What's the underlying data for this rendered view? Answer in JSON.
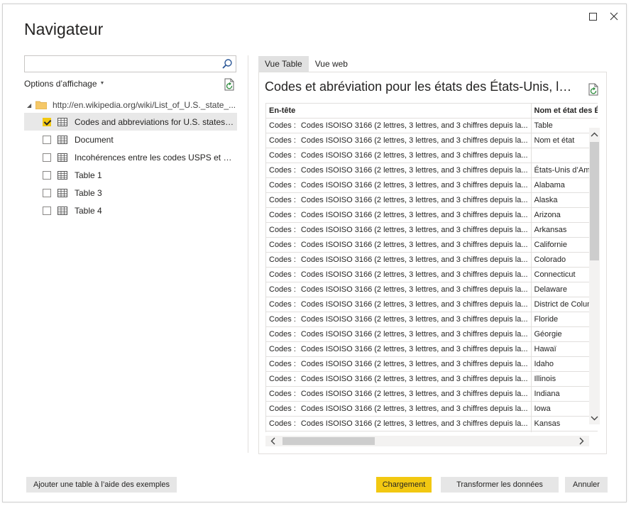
{
  "window": {
    "title": "Navigateur",
    "maximize_icon": "maximize-icon",
    "close_icon": "close-icon"
  },
  "left": {
    "search": {
      "value": "",
      "placeholder": ""
    },
    "display_options": "Options d’affichage",
    "tree": {
      "root_url": "http://en.wikipedia.org/wiki/List_of_U.S._state_...",
      "items": [
        {
          "label": "Codes and abbreviations for U.S. states, ...",
          "checked": true,
          "selected": true
        },
        {
          "label": "Document",
          "checked": false,
          "selected": false
        },
        {
          "label": "Incohérences entre les codes USPS et USCG",
          "checked": false,
          "selected": false
        },
        {
          "label": "Table 1",
          "checked": false,
          "selected": false
        },
        {
          "label": "Table 3",
          "checked": false,
          "selected": false
        },
        {
          "label": "Table 4",
          "checked": false,
          "selected": false
        }
      ]
    }
  },
  "right": {
    "tabs": [
      {
        "label": "Vue Table",
        "active": true
      },
      {
        "label": "Vue web",
        "active": false
      }
    ],
    "preview_title": "Codes et abréviation pour les états des États-Unis, les dis...",
    "table": {
      "headers": [
        "En-tête",
        "",
        "Nom et état des É..."
      ],
      "rows": [
        [
          "Codes :",
          "Codes ISOISO 3166 (2 lettres, 3 lettres, and 3 chiffres depuis la...",
          "Table"
        ],
        [
          "Codes :",
          "Codes ISOISO 3166 (2 lettres, 3 lettres, and 3 chiffres depuis la...",
          "Nom et état"
        ],
        [
          "Codes :",
          "Codes ISOISO 3166 (2 lettres, 3 lettres, and 3 chiffres depuis la...",
          ""
        ],
        [
          "Codes :",
          "Codes ISOISO 3166 (2 lettres, 3 lettres, and 3 chiffres depuis la...",
          "États-Unis d’Amér"
        ],
        [
          "Codes :",
          "Codes ISOISO 3166 (2 lettres, 3 lettres, and 3 chiffres depuis la...",
          "Alabama"
        ],
        [
          "Codes :",
          "Codes ISOISO 3166 (2 lettres, 3 lettres, and 3 chiffres depuis la...",
          "Alaska"
        ],
        [
          "Codes :",
          "Codes ISOISO 3166 (2 lettres, 3 lettres, and 3 chiffres depuis la...",
          "Arizona"
        ],
        [
          "Codes :",
          "Codes ISOISO 3166 (2 lettres, 3 lettres, and 3 chiffres depuis la...",
          "Arkansas"
        ],
        [
          "Codes :",
          "Codes ISOISO 3166 (2 lettres, 3 lettres, and 3 chiffres depuis la...",
          "Californie"
        ],
        [
          "Codes :",
          "Codes ISOISO 3166 (2 lettres, 3 lettres, and 3 chiffres depuis la...",
          "Colorado"
        ],
        [
          "Codes :",
          "Codes ISOISO 3166 (2 lettres, 3 lettres, and 3 chiffres depuis la...",
          "Connecticut"
        ],
        [
          "Codes :",
          "Codes ISOISO 3166 (2 lettres, 3 lettres, and 3 chiffres depuis la...",
          "Delaware"
        ],
        [
          "Codes :",
          "Codes ISOISO 3166 (2 lettres, 3 lettres, and 3 chiffres depuis la...",
          "District de Columl"
        ],
        [
          "Codes :",
          "Codes ISOISO 3166 (2 lettres, 3 lettres, and 3 chiffres depuis la...",
          "Floride"
        ],
        [
          "Codes :",
          "Codes ISOISO 3166 (2 lettres, 3 lettres, and 3 chiffres depuis la...",
          "Géorgie"
        ],
        [
          "Codes :",
          "Codes ISOISO 3166 (2 lettres, 3 lettres, and 3 chiffres depuis la...",
          "Hawaï"
        ],
        [
          "Codes :",
          "Codes ISOISO 3166 (2 lettres, 3 lettres, and 3 chiffres depuis la...",
          "Idaho"
        ],
        [
          "Codes :",
          "Codes ISOISO 3166 (2 lettres, 3 lettres, and 3 chiffres depuis la...",
          "Illinois"
        ],
        [
          "Codes :",
          "Codes ISOISO 3166 (2 lettres, 3 lettres, and 3 chiffres depuis la...",
          "Indiana"
        ],
        [
          "Codes :",
          "Codes ISOISO 3166 (2 lettres, 3 lettres, and 3 chiffres depuis la...",
          "Iowa"
        ],
        [
          "Codes :",
          "Codes ISOISO 3166 (2 lettres, 3 lettres, and 3 chiffres depuis la...",
          "Kansas"
        ],
        [
          "",
          "",
          ""
        ]
      ]
    }
  },
  "footer": {
    "examples_button": "Ajouter une table à l’aide des exemples",
    "load_button": "Chargement",
    "transform_button": "Transformer les données",
    "cancel_button": "Annuler"
  },
  "colors": {
    "accent": "#f2c811",
    "selected_row": "#e8e8e8",
    "button_bg": "#e6e6e6",
    "border": "#e1dfdd"
  }
}
